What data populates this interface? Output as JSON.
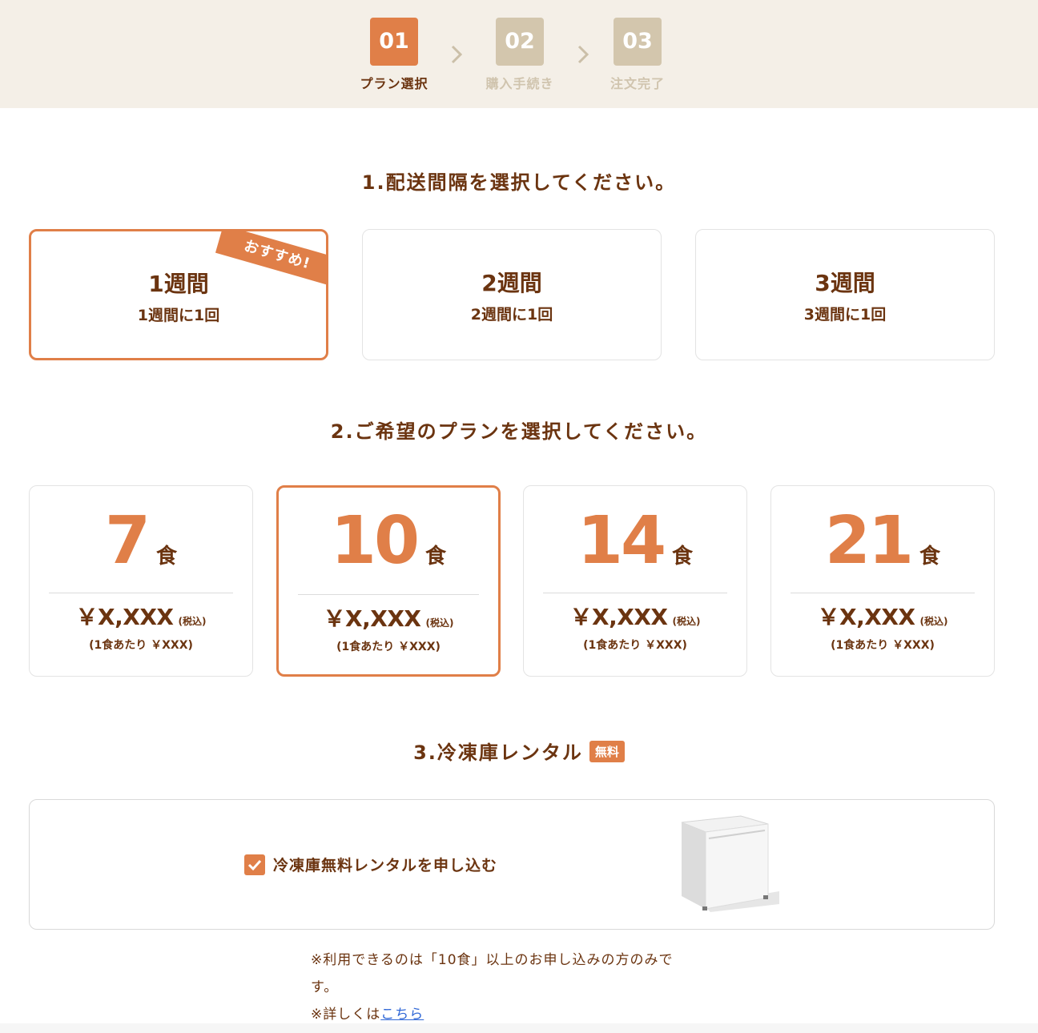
{
  "stepper": {
    "steps": [
      {
        "num": "01",
        "label": "プラン選択",
        "state": "active"
      },
      {
        "num": "02",
        "label": "購入手続き",
        "state": "inactive"
      },
      {
        "num": "03",
        "label": "注文完了",
        "state": "inactive"
      }
    ]
  },
  "section1": {
    "no": "1.",
    "title": "配送間隔を選択してください。"
  },
  "intervals": [
    {
      "title": "1週間",
      "sub": "1週間に1回",
      "selected": true,
      "ribbon": "おすすめ!"
    },
    {
      "title": "2週間",
      "sub": "2週間に1回",
      "selected": false
    },
    {
      "title": "3週間",
      "sub": "3週間に1回",
      "selected": false
    }
  ],
  "section2": {
    "no": "2.",
    "title": "ご希望のプランを選択してください。"
  },
  "plans": [
    {
      "count": "7",
      "unit": "食",
      "price": "￥X,XXX",
      "tax": "(税込)",
      "per": "(1食あたり ￥XXX)",
      "selected": false
    },
    {
      "count": "10",
      "unit": "食",
      "price": "￥X,XXX",
      "tax": "(税込)",
      "per": "(1食あたり ￥XXX)",
      "selected": true
    },
    {
      "count": "14",
      "unit": "食",
      "price": "￥X,XXX",
      "tax": "(税込)",
      "per": "(1食あたり ￥XXX)",
      "selected": false
    },
    {
      "count": "21",
      "unit": "食",
      "price": "￥X,XXX",
      "tax": "(税込)",
      "per": "(1食あたり ￥XXX)",
      "selected": false
    }
  ],
  "section3": {
    "no": "3.",
    "title": "冷凍庫レンタル",
    "badge": "無料"
  },
  "freezer": {
    "checkbox_label": "冷凍庫無料レンタルを申し込む",
    "checked": true
  },
  "notes": {
    "line1": "※利用できるのは「10食」以上のお申し込みの方のみです。",
    "line2_prefix": "※詳しくは",
    "line2_link": "こちら"
  },
  "colors": {
    "accent": "#e07f48",
    "text": "#6b3410",
    "stepper_bg": "#f4efe7",
    "inactive_step": "#d3c6ad",
    "link": "#2f67d6"
  }
}
